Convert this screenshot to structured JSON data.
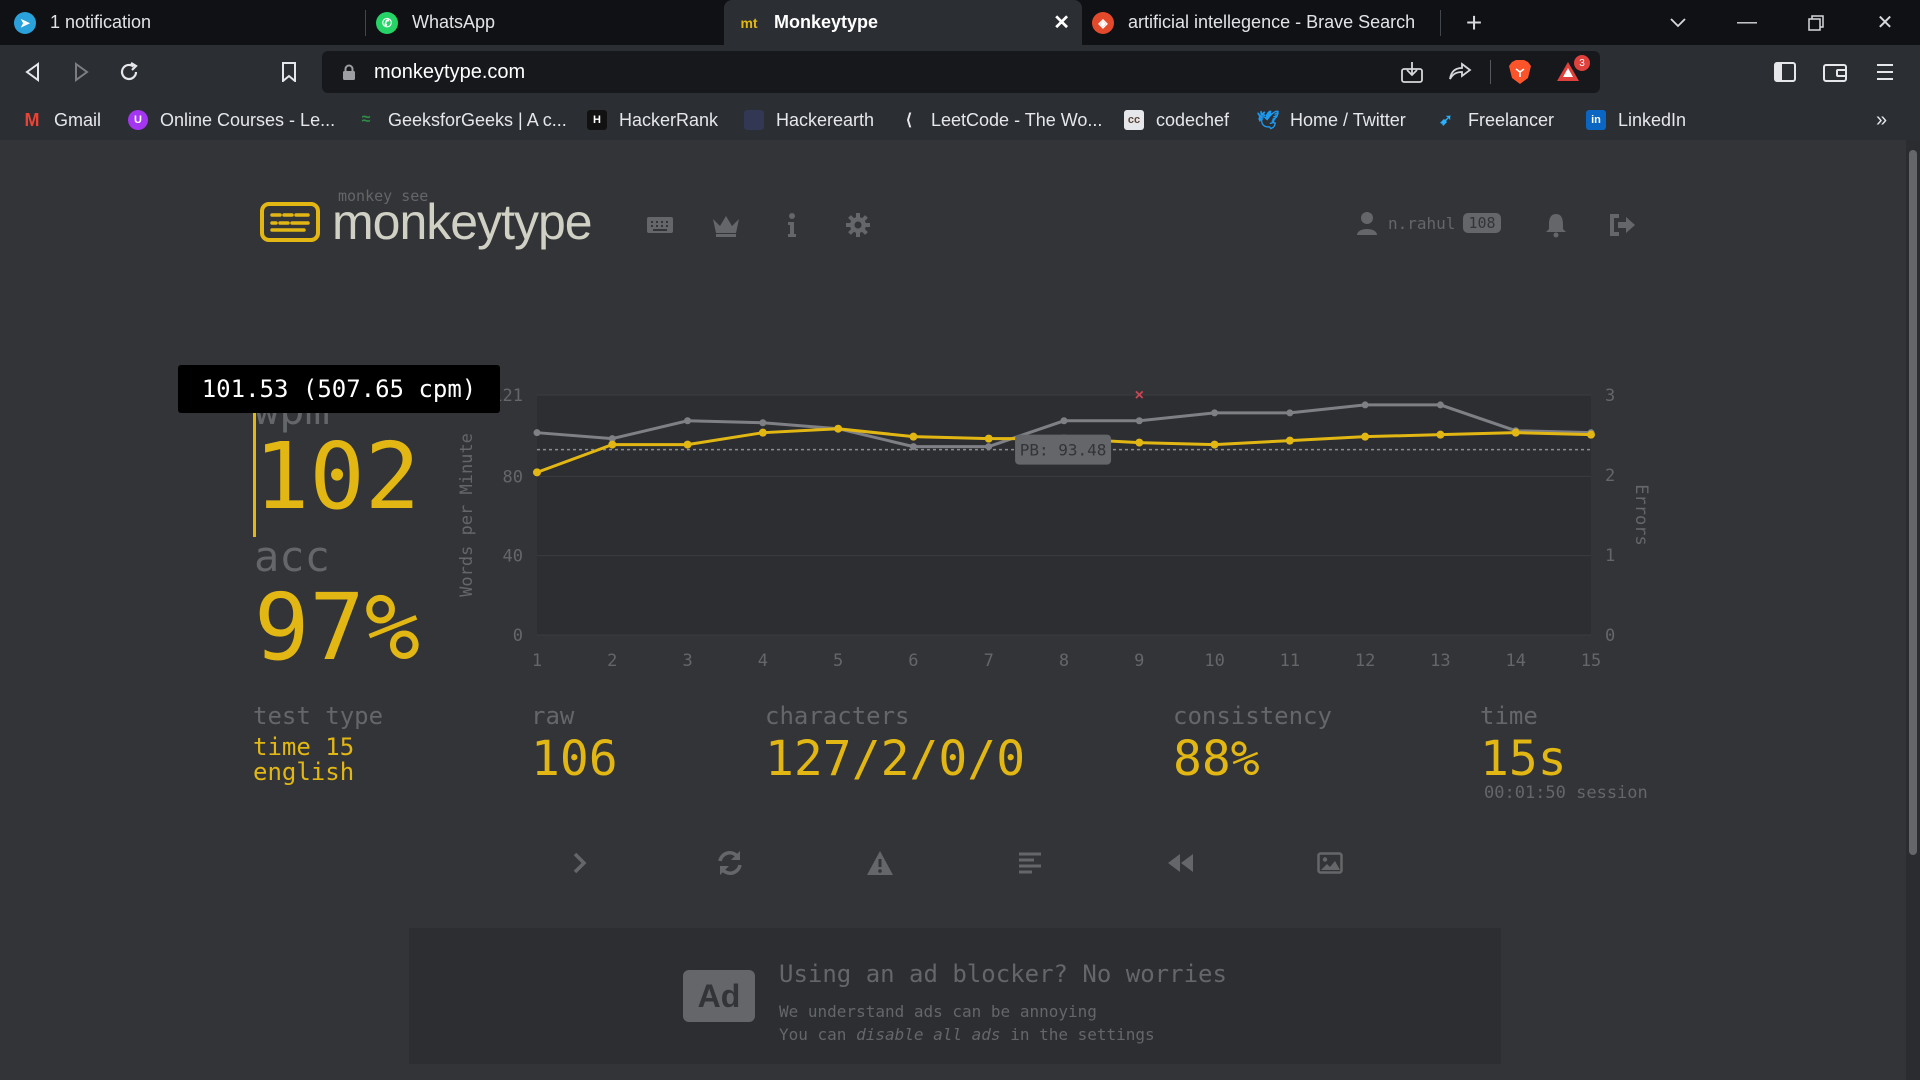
{
  "browser": {
    "tabs": [
      {
        "label": "1 notification",
        "icon": "telegram-icon",
        "color": "#2aa1da"
      },
      {
        "label": "WhatsApp",
        "icon": "whatsapp-icon",
        "color": "#25d366"
      },
      {
        "label": "Monkeytype",
        "icon": "monkeytype-icon",
        "color": "#e2b714",
        "icon_text": "mt",
        "active": true
      },
      {
        "label": "artificial intellegence - Brave Search",
        "icon": "brave-search-icon",
        "color": "#e24a2b"
      }
    ],
    "url": "monkeytype.com",
    "brave_badge": "3",
    "bookmarks": [
      {
        "label": "Gmail",
        "icon": "gmail-icon",
        "color": "#ea4335",
        "icon_text": "M"
      },
      {
        "label": "Online Courses - Le...",
        "icon": "udemy-icon",
        "color": "#a435f0",
        "icon_text": "U"
      },
      {
        "label": "GeeksforGeeks | A c...",
        "icon": "geeksforgeeks-icon",
        "color": "#2f8d46",
        "icon_text": "≈"
      },
      {
        "label": "HackerRank",
        "icon": "hackerrank-icon",
        "color": "#111111",
        "icon_text": "H"
      },
      {
        "label": "Hackerearth",
        "icon": "hackerearth-icon",
        "color": "#323754",
        "icon_text": ""
      },
      {
        "label": "LeetCode - The Wo...",
        "icon": "leetcode-icon",
        "color": "#2b2e33",
        "icon_text": "L"
      },
      {
        "label": "codechef",
        "icon": "codechef-icon",
        "color": "#5b4638",
        "icon_text": "cc"
      },
      {
        "label": "Home / Twitter",
        "icon": "twitter-icon",
        "color": "#1d9bf0",
        "icon_text": "t"
      },
      {
        "label": "Freelancer",
        "icon": "freelancer-icon",
        "color": "#29b2fe",
        "icon_text": "f"
      },
      {
        "label": "LinkedIn",
        "icon": "linkedin-icon",
        "color": "#0a66c2",
        "icon_text": "in"
      }
    ]
  },
  "app": {
    "logo_small": "monkey see",
    "logo_text": "monkeytype",
    "username": "n.rahul",
    "level": "108",
    "accent": "#e2b714",
    "sub_color": "#646669",
    "bg": "#323437"
  },
  "result": {
    "tooltip": "101.53 (507.65 cpm)",
    "wpm_label": "wpm",
    "wpm": "102",
    "acc_label": "acc",
    "acc": "97%",
    "test_type_label": "test type",
    "test_type_mode": "time 15",
    "test_type_lang": "english",
    "raw_label": "raw",
    "raw": "106",
    "characters_label": "characters",
    "characters": "127/2/0/0",
    "consistency_label": "consistency",
    "consistency": "88%",
    "time_label": "time",
    "time": "15s",
    "session": "00:01:50 session"
  },
  "chart_data": {
    "type": "line",
    "x": [
      1,
      2,
      3,
      4,
      5,
      6,
      7,
      8,
      9,
      10,
      11,
      12,
      13,
      14,
      15
    ],
    "ylabel": "Words per Minute",
    "y2label": "Errors",
    "ylim": [
      0,
      121
    ],
    "y2lim": [
      0,
      3
    ],
    "yticks": [
      0,
      40,
      80,
      121
    ],
    "ytick_labels": [
      "0",
      "40",
      "80",
      "121"
    ],
    "y2ticks": [
      0,
      1,
      2,
      3
    ],
    "pb_label": "PB: 93.48",
    "pb_value": 93.48,
    "series": [
      {
        "role": "raw",
        "color": "#7e8085",
        "values": [
          102,
          99,
          108,
          107,
          104,
          95,
          95,
          108,
          108,
          112,
          112,
          116,
          116,
          103,
          102
        ]
      },
      {
        "role": "wpm",
        "color": "#e2b714",
        "values": [
          82,
          96,
          96,
          102,
          104,
          100,
          99,
          99,
          97,
          96,
          98,
          100,
          101,
          102,
          101
        ]
      }
    ],
    "errors": [
      {
        "x": 9,
        "y": 3
      }
    ]
  }
}
